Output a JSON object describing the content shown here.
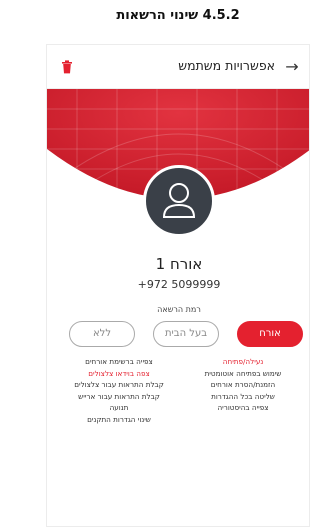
{
  "doc_heading": "4.5.2 שינוי הרשאות",
  "topbar": {
    "title": "אפשרויות משתמש",
    "back_icon": "arrow-right-icon",
    "delete_icon": "trash-icon"
  },
  "user": {
    "name": "אורח 1",
    "phone": "+972 5099999"
  },
  "permission_level_label": "רמת הרשאה",
  "levels": [
    {
      "label": "אורח",
      "selected": true
    },
    {
      "label": "בעל הבית",
      "selected": false
    },
    {
      "label": "ללא",
      "selected": false
    }
  ],
  "permissions": {
    "right_column": [
      {
        "text": "נעילה/פתיחה",
        "highlight": true
      },
      {
        "text": "שימוש בפתיחה אוטומטית",
        "highlight": false
      },
      {
        "text": "הזמנת/הסרת אורחים",
        "highlight": false
      },
      {
        "text": "שליטה בכל ההגדרות",
        "highlight": false
      },
      {
        "text": "צפייה בהיסטוריה",
        "highlight": false
      }
    ],
    "left_column": [
      {
        "text": "צפייה ברשימת אורחים",
        "highlight": false
      },
      {
        "text": "צפה בוידאו צלצולים",
        "highlight": true
      },
      {
        "text": "קבלת התראות עבור צלצולים",
        "highlight": false
      },
      {
        "text": "קבלת התראות עבור ארייש",
        "highlight": false
      },
      {
        "text": "תנועה",
        "highlight": false
      },
      {
        "text": "שינוי הגדרות התקנים",
        "highlight": false
      }
    ]
  },
  "colors": {
    "accent": "#e4212f",
    "hero": "#d51e2e",
    "avatar": "#3a4048"
  }
}
